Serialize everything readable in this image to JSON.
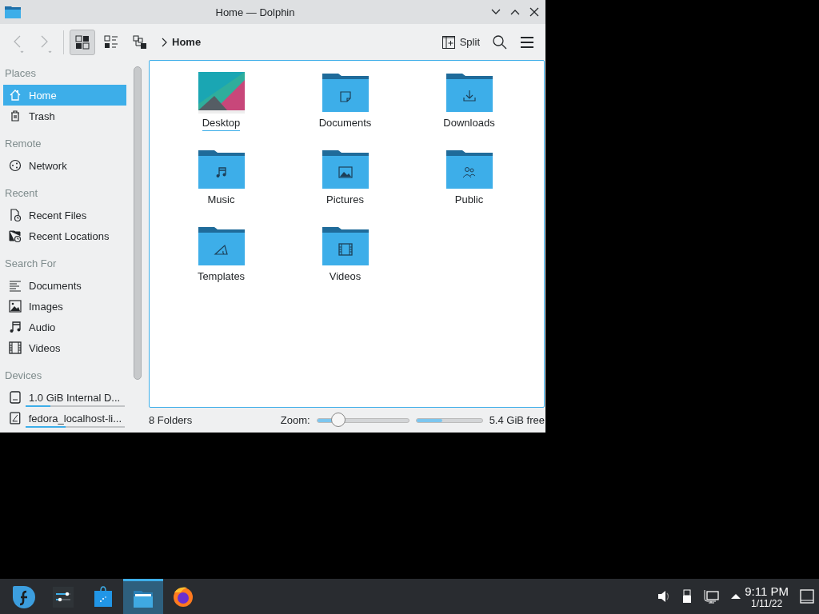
{
  "window": {
    "title": "Home — Dolphin"
  },
  "toolbar": {
    "view_modes": [
      {
        "kind": "icons",
        "selected": true
      },
      {
        "kind": "compact",
        "selected": false
      },
      {
        "kind": "details",
        "selected": false
      }
    ],
    "breadcrumb": "Home",
    "split": "Split"
  },
  "sidebar": {
    "sections": [
      {
        "heading": "Places",
        "items": [
          {
            "label": "Home",
            "kind": "home",
            "selected": true
          },
          {
            "label": "Trash",
            "kind": "trash",
            "selected": false
          }
        ]
      },
      {
        "heading": "Remote",
        "items": [
          {
            "label": "Network",
            "kind": "network",
            "selected": false
          }
        ]
      },
      {
        "heading": "Recent",
        "items": [
          {
            "label": "Recent Files",
            "kind": "recent-file",
            "selected": false
          },
          {
            "label": "Recent Locations",
            "kind": "recent-folder",
            "selected": false
          }
        ]
      },
      {
        "heading": "Search For",
        "items": [
          {
            "label": "Documents",
            "kind": "documents",
            "selected": false
          },
          {
            "label": "Images",
            "kind": "images",
            "selected": false
          },
          {
            "label": "Audio",
            "kind": "audio",
            "selected": false
          },
          {
            "label": "Videos",
            "kind": "videos",
            "selected": false
          }
        ]
      },
      {
        "heading": "Devices",
        "items": [
          {
            "label": "1.0 GiB Internal D...",
            "kind": "drive",
            "selected": false,
            "level": 0.25
          },
          {
            "label": "fedora_localhost-li...",
            "kind": "disk",
            "selected": false,
            "level": 0.4
          }
        ]
      }
    ]
  },
  "files": [
    {
      "name": "Desktop",
      "kind": "desktop",
      "focused": true
    },
    {
      "name": "Documents",
      "kind": "documents",
      "focused": false
    },
    {
      "name": "Downloads",
      "kind": "downloads",
      "focused": false
    },
    {
      "name": "Music",
      "kind": "music",
      "focused": false
    },
    {
      "name": "Pictures",
      "kind": "pictures",
      "focused": false
    },
    {
      "name": "Public",
      "kind": "public",
      "focused": false
    },
    {
      "name": "Templates",
      "kind": "templates",
      "focused": false
    },
    {
      "name": "Videos",
      "kind": "videos",
      "focused": false
    }
  ],
  "status_bar": {
    "count": "8 Folders",
    "zoom_label": "Zoom:",
    "zoom": {
      "level": 0.23
    },
    "free_space": {
      "level": 0.4
    },
    "free_text": "5.4 GiB free"
  },
  "taskbar": {
    "apps": [
      {
        "kind": "launcher",
        "active": false
      },
      {
        "kind": "settings",
        "active": false
      },
      {
        "kind": "store",
        "active": false
      },
      {
        "kind": "files",
        "active": true
      },
      {
        "kind": "browser",
        "active": false
      }
    ],
    "time": "9:11 PM",
    "date": "1/11/22"
  }
}
